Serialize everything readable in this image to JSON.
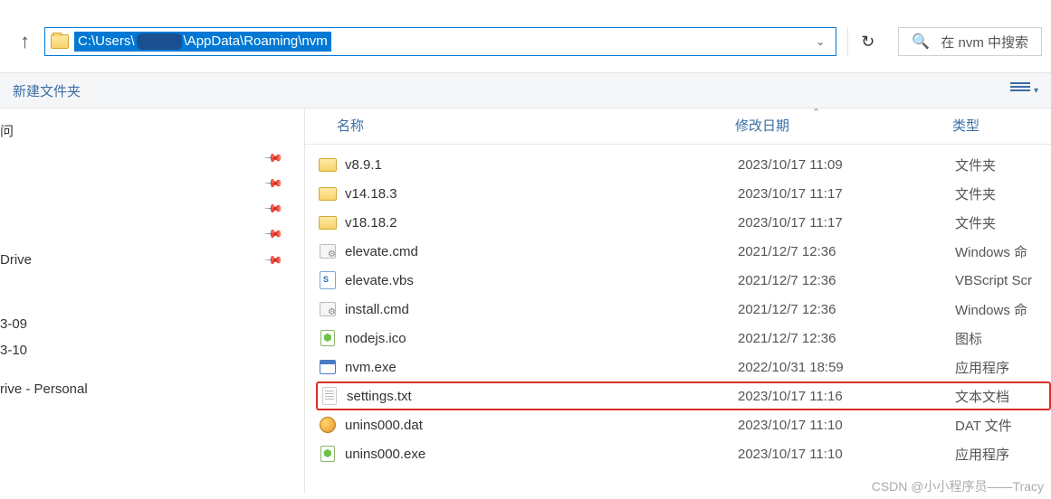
{
  "addressbar": {
    "prefix": "C:\\Users\\",
    "suffix": "\\AppData\\Roaming\\nvm"
  },
  "search": {
    "placeholder": "在 nvm 中搜索"
  },
  "toolbar": {
    "new_folder": "新建文件夹"
  },
  "sidebar": {
    "quick_access": "问",
    "drive": "Drive",
    "item_a": "3-09",
    "item_b": "3-10",
    "personal": "rive - Personal"
  },
  "columns": {
    "name": "名称",
    "date": "修改日期",
    "type": "类型"
  },
  "files": [
    {
      "name": "v8.9.1",
      "date": "2023/10/17 11:09",
      "type": "文件夹",
      "icon": "folder"
    },
    {
      "name": "v14.18.3",
      "date": "2023/10/17 11:17",
      "type": "文件夹",
      "icon": "folder"
    },
    {
      "name": "v18.18.2",
      "date": "2023/10/17 11:17",
      "type": "文件夹",
      "icon": "folder"
    },
    {
      "name": "elevate.cmd",
      "date": "2021/12/7 12:36",
      "type": "Windows 命",
      "icon": "cmd"
    },
    {
      "name": "elevate.vbs",
      "date": "2021/12/7 12:36",
      "type": "VBScript Scr",
      "icon": "vbs"
    },
    {
      "name": "install.cmd",
      "date": "2021/12/7 12:36",
      "type": "Windows 命",
      "icon": "cmd"
    },
    {
      "name": "nodejs.ico",
      "date": "2021/12/7 12:36",
      "type": "图标",
      "icon": "node"
    },
    {
      "name": "nvm.exe",
      "date": "2022/10/31 18:59",
      "type": "应用程序",
      "icon": "exe"
    },
    {
      "name": "settings.txt",
      "date": "2023/10/17 11:16",
      "type": "文本文档",
      "icon": "txt",
      "highlight": true
    },
    {
      "name": "unins000.dat",
      "date": "2023/10/17 11:10",
      "type": "DAT 文件",
      "icon": "dat"
    },
    {
      "name": "unins000.exe",
      "date": "2023/10/17 11:10",
      "type": "应用程序",
      "icon": "node"
    }
  ],
  "watermark": "CSDN @小小程序员——Tracy"
}
